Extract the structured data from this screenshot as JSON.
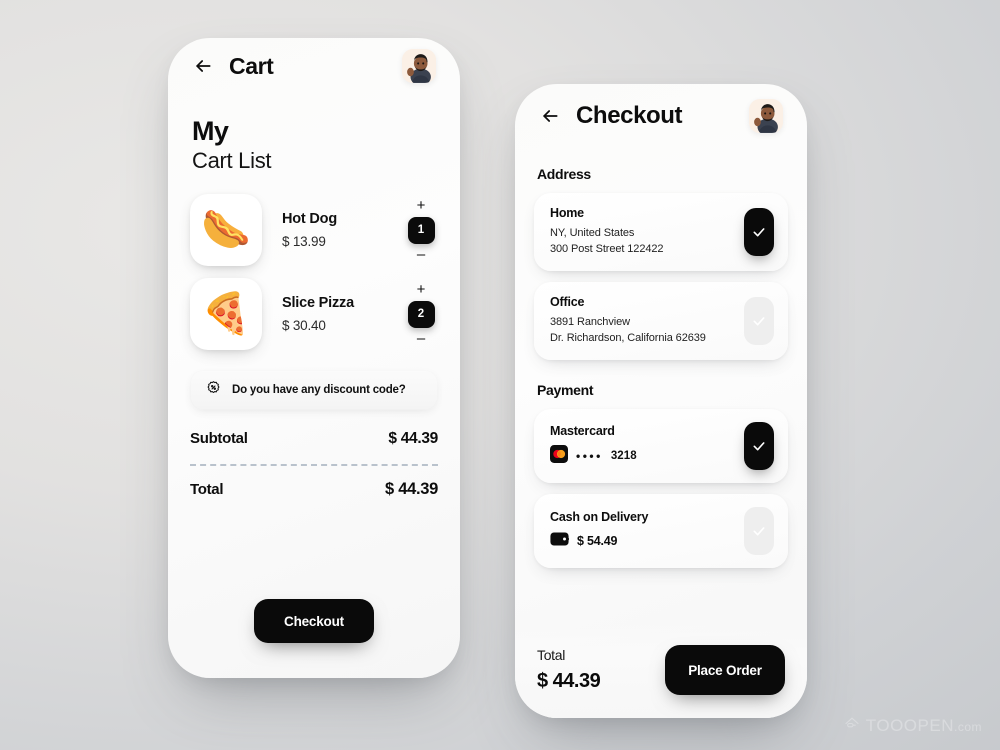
{
  "cart_screen": {
    "back_icon": "arrow-left-icon",
    "title": "Cart",
    "avatar": "user-avatar",
    "heading_line1": "My",
    "heading_line2": "Cart List",
    "items": [
      {
        "image": "hotdog-emoji",
        "glyph": "🌭",
        "name": "Hot Dog",
        "price": "$ 13.99",
        "plus": "+",
        "qty": "1",
        "minus": "–"
      },
      {
        "image": "pizza-emoji",
        "glyph": "🍕",
        "name": "Slice Pizza",
        "price": "$ 30.40",
        "plus": "+",
        "qty": "2",
        "minus": "–"
      }
    ],
    "discount": {
      "icon": "discount-badge-icon",
      "label": "Do you have any discount code?"
    },
    "subtotal_label": "Subtotal",
    "subtotal_value": "$ 44.39",
    "total_label": "Total",
    "total_value": "$ 44.39",
    "checkout_button": "Checkout"
  },
  "checkout_screen": {
    "back_icon": "arrow-left-icon",
    "title": "Checkout",
    "avatar": "user-avatar",
    "address_section": "Address",
    "addresses": [
      {
        "title": "Home",
        "line1": "NY, United States",
        "line2": "300 Post Street 122422",
        "selected": true
      },
      {
        "title": "Office",
        "line1": "3891 Ranchview",
        "line2": "Dr. Richardson, California 62639",
        "selected": false
      }
    ],
    "payment_section": "Payment",
    "payments": [
      {
        "title": "Mastercard",
        "icon": "mastercard-icon",
        "dots": "••••",
        "last4": "3218",
        "selected": true
      },
      {
        "title": "Cash on Delivery",
        "icon": "wallet-icon",
        "amount": "$ 54.49",
        "selected": false
      }
    ],
    "total_label": "Total",
    "total_value": "$ 44.39",
    "place_order_button": "Place Order"
  },
  "watermark": {
    "icon": "house-cloud-icon",
    "text": "TOOOPEN",
    "suffix": ".com"
  },
  "colors": {
    "accent_dark": "#0a0a0a",
    "card_bg": "#ffffff",
    "screen_bg": "#fbfbfa",
    "unselected_box": "#eeeeee",
    "dashed_divider": "#b9c2cc",
    "mastercard_red": "#eb001b",
    "mastercard_orange": "#f79e1b"
  }
}
